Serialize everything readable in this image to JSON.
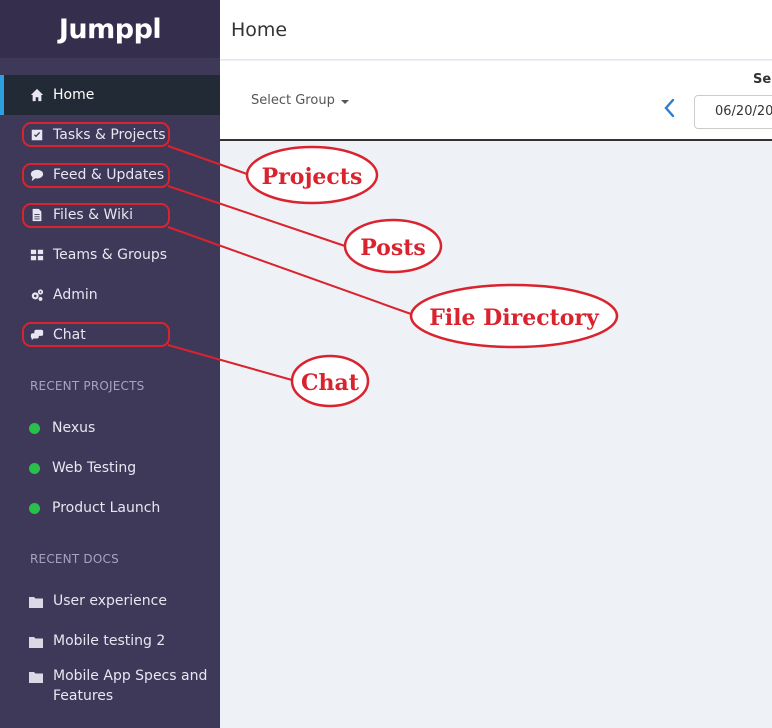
{
  "app": {
    "logo": "Jumppl"
  },
  "header": {
    "title": "Home"
  },
  "nav": [
    {
      "label": "Home",
      "icon": "home-icon"
    },
    {
      "label": "Tasks & Projects",
      "icon": "checkbox-icon"
    },
    {
      "label": "Feed & Updates",
      "icon": "comment-icon"
    },
    {
      "label": "Files & Wiki",
      "icon": "file-icon"
    },
    {
      "label": "Teams & Groups",
      "icon": "grid-icon"
    },
    {
      "label": "Admin",
      "icon": "gears-icon"
    },
    {
      "label": "Chat",
      "icon": "chat-icon"
    }
  ],
  "recent_projects": {
    "title": "RECENT PROJECTS",
    "items": [
      {
        "label": "Nexus",
        "status_color": "#27c04a"
      },
      {
        "label": "Web Testing",
        "status_color": "#27c04a"
      },
      {
        "label": "Product Launch",
        "status_color": "#27c04a"
      }
    ]
  },
  "recent_docs": {
    "title": "RECENT DOCS",
    "items": [
      {
        "label": "User experience",
        "icon": "folder-icon"
      },
      {
        "label": "Mobile testing 2",
        "icon": "folder-icon"
      },
      {
        "label": "Mobile App Specs and Features",
        "icon": "folder-icon"
      }
    ]
  },
  "toolbar": {
    "select_group": "Select Group",
    "select_label": "Sel",
    "date_value": "06/20/20"
  },
  "annotations": [
    {
      "label": "Projects"
    },
    {
      "label": "Posts"
    },
    {
      "label": "File Directory"
    },
    {
      "label": "Chat"
    }
  ],
  "colors": {
    "annotation": "#d9232e",
    "sidebar": "#3e3859",
    "active": "#2e9fe0"
  }
}
